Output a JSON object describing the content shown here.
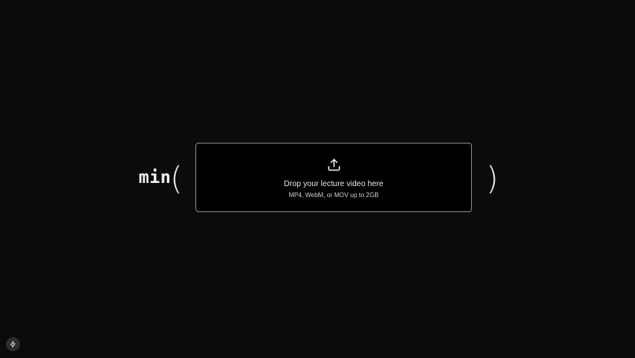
{
  "expression": {
    "function_name": "min",
    "open_paren": "(",
    "close_paren": ")"
  },
  "upload": {
    "icon": "upload-icon",
    "title": "Drop your lecture video here",
    "subtitle": "MP4, WebM, or MOV up to 2GB"
  },
  "corner_button": {
    "icon": "bolt-icon"
  },
  "colors": {
    "background": "#0b0b0b",
    "dropzone_background": "#000000",
    "dropzone_border": "#8a8a8a",
    "text": "#e6e6e6"
  }
}
